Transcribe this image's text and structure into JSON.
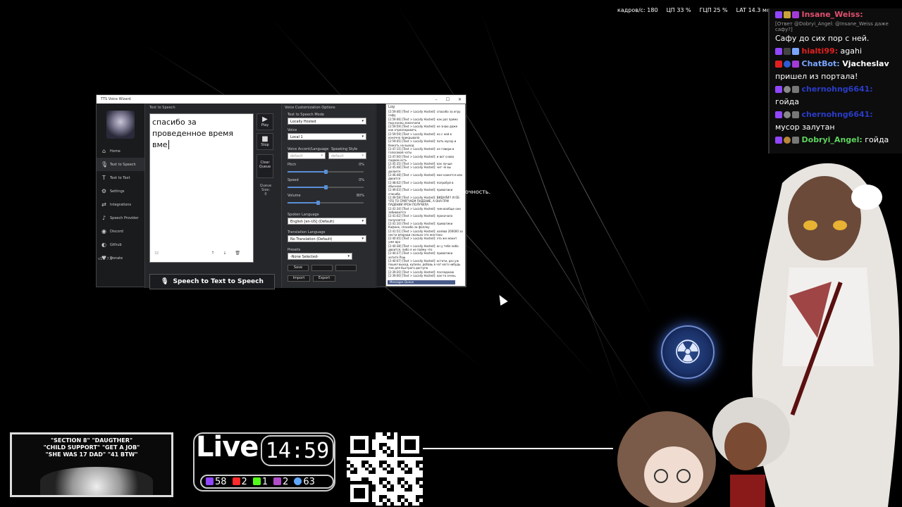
{
  "stats": {
    "fps": "кадров/с: 180",
    "cpu": "ЦП 33 %",
    "gpu": "ГЦП 25 %",
    "latency": "LAT 14.3 мс"
  },
  "chat": {
    "messages": [
      {
        "user": "Insane_Weiss:",
        "text": "",
        "color": "#e0506e"
      },
      {
        "reply": "[Ответ @Dobryi_Angel: @Insane_Weiss даже сафу?]"
      },
      {
        "user": "",
        "text": "Сафу до сих пор с ней.",
        "color": "#fff"
      },
      {
        "user": "hialti99:",
        "text": "agahi",
        "color": "#e02020"
      },
      {
        "user": "ChatBot:",
        "text": "Vjacheslav",
        "color": "#7aa5ff"
      },
      {
        "user": "",
        "text": "пришел из портала!",
        "color": "#fff"
      },
      {
        "user": "chernohng6641:",
        "text": "",
        "color": "#2a3cc8"
      },
      {
        "user": "",
        "text": "гойда",
        "color": "#fff"
      },
      {
        "user": "chernohng6641:",
        "text": "",
        "color": "#2a3cc8"
      },
      {
        "user": "",
        "text": "мусор залутан",
        "color": "#fff"
      },
      {
        "user": "Dobryi_Angel:",
        "text": "гойда",
        "color": "#5fd35f"
      }
    ]
  },
  "window": {
    "title": "TTS Voice Wizard",
    "controls": [
      "–",
      "☐",
      "✕"
    ],
    "version": "v1.7.7.8",
    "nav": [
      {
        "label": "Home",
        "icon": "⌂"
      },
      {
        "label": "Text to Speech",
        "icon": "🎙"
      },
      {
        "label": "Text to Text",
        "icon": "T"
      },
      {
        "label": "Settings",
        "icon": "⚙"
      },
      {
        "label": "Integrations",
        "icon": "⇄"
      },
      {
        "label": "Speech Provider",
        "icon": "♪"
      },
      {
        "label": "Discord",
        "icon": "◉"
      },
      {
        "label": "Github",
        "icon": "◐"
      },
      {
        "label": "Donate",
        "icon": "♥"
      }
    ]
  },
  "tts": {
    "section_label": "Text to Speech",
    "text_value": "спасибо за проведенное время вме",
    "char_count": "32",
    "play_label": "Play",
    "stop_label": "Stop",
    "clear_queue_label": "Clear Queue",
    "queue_size_label": "Queue Size:",
    "queue_size_value": "0",
    "main_button_label": "Speech to Text to Speech"
  },
  "voice": {
    "section_label": "Voice Customization Options",
    "tts_mode_label": "Text to Speech Mode",
    "tts_mode_value": "Locally Hosted",
    "voice_label": "Voice",
    "voice_value": "Local 1",
    "accent_label": "Voice Accent/Language",
    "accent_value": "default",
    "style_label": "Speaking Style",
    "style_value": "default",
    "pitch_label": "Pitch",
    "pitch_value": "0%",
    "pitch_level": 0.5,
    "speed_label": "Speed",
    "speed_value": "0%",
    "speed_level": 0.5,
    "volume_label": "Volume",
    "volume_value": "80%",
    "volume_level": 0.4,
    "spoken_lang_label": "Spoken Language",
    "spoken_lang_value": "English [en-US] (Default)",
    "translation_lang_label": "Translation Language",
    "translation_lang_value": "No Translation (Default)",
    "presets_label": "Presets",
    "presets_value": "-None Selected-",
    "save_label": "Save",
    "import_label": "Import",
    "export_label": "Export"
  },
  "log": {
    "label": "Log",
    "text": "[2:59:46] [Text > Locally Hosted]: спасибо за игру сафу\n[2:59:46] [Text > Locally Hosted]: как раз прямо под конец закончили\n[2:59:59] [Text > Locally Hosted]: не знаю даже как отреагировать\n[2:59:59] [Text > Locally Hosted]: но с ней в конечно прикрывала\n[2:59:45] [Text > Locally Hosted]: пить мусор и бежать на выход\n[2:47:15] [Text > Locally Hosted]: не говори в голосовой чаты\n[2:47:00] [Text > Locally Hosted]: и вот снова падаем есть\n[2:45:35] [Text > Locally Hosted]: как лучше\n[2:45:48] [Text > Locally Hosted]: чит че вы делаете\n[2:46:48] [Text > Locally Hosted]: мне кажется или двоится\n[2:48:02] [Text > Locally Hosted]: попробуй в обычном\n[2:49:03] [Text > Locally Hosted]: приватики спасибо\n[2:49:58] [Text > Locally Hosted]: ВИДАЛИ!! И ОБ ЧТО ТО СМЯГЧАЕМ ПАДЕНИЕ, А ОНА ПРИ ПАДЕНИИ УРОН ПОЛУЧИЛА\n[2:41:34] [Text > Locally Hosted]: чим вообще они забиваются\n[2:41:02] [Text > Locally Hosted]: прокачала получается\n[2:41:10] [Text > Locally Hosted]: приватики Кафеек, спасибо за фоллоу\n[2:41:51] [Text > Locally Hosted]: халява 200000 за нести впереди сколько это жестоко\n[2:40:45] [Text > Locally Hosted]: это же манит уже вро\n[2:40:38] [Text > Locally Hosted]: он у тебя либо двоится, либо я не пойму что\n[2:40:27] [Text > Locally Hosted]: приватики хотите Раш\n[2:40:07] [Text > Locally Hosted]: кстати, раз уж пошел выход, купили, добавь в чат кого нибудь там для быстрого доступа\n[2:39:20] [Text > Locally Hosted]: последнюю\n[2:39:00] [Text > Locally Hosted]: как-то очень хорошо выглядишь\n[2:38:59] [Text > Locally Hosted]: минимально через",
    "footer": "Messages Queue"
  },
  "floating_text": "очность.",
  "overlay": {
    "meme_lines": [
      "\"SECTION 8\" \"DAUGTHER\"",
      "\"CHILD SUPPORT\" \"GET A JOB\"",
      "\"SHE WAS 17 DAD\" \"41 BTW\""
    ],
    "live_label": "Live",
    "live_time": "14:59",
    "counts": [
      {
        "name": "twitch",
        "value": "58",
        "color": "#9146ff"
      },
      {
        "name": "youtube",
        "value": "2",
        "color": "#ff2a2a"
      },
      {
        "name": "kick",
        "value": "1",
        "color": "#53fc18"
      },
      {
        "name": "vk",
        "value": "2",
        "color": "#b04cc8"
      },
      {
        "name": "total",
        "value": "63",
        "color": "#5fa8ff"
      }
    ]
  }
}
